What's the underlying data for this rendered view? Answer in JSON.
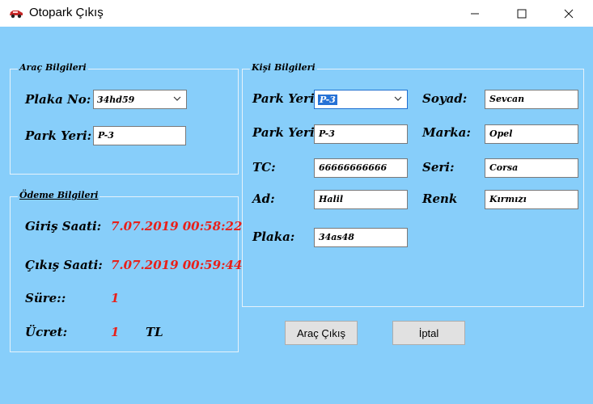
{
  "window": {
    "title": "Otopark Çıkış",
    "minimize_glyph": "—",
    "maximize_glyph": "☐",
    "close_glyph": "✕"
  },
  "arac_group": {
    "title": "Araç Bilgileri",
    "plaka_label": "Plaka No:",
    "plaka_value": "34hd59",
    "park_label": "Park Yeri:",
    "park_value": "P-3"
  },
  "odeme_group": {
    "title": "Ödeme Bilgileri",
    "giris_label": "Giriş Saati:",
    "giris_value": "7.07.2019 00:58:22",
    "cikis_label": "Çıkış Saati:",
    "cikis_value": "7.07.2019 00:59:44",
    "sure_label": "Süre::",
    "sure_value": "1",
    "ucret_label": "Ücret:",
    "ucret_value": "1",
    "ucret_unit": "TL"
  },
  "kisi_group": {
    "title": "Kişi Bilgileri",
    "park_combo_label": "Park Yeri",
    "park_combo_value": "P-3",
    "park_text_label": "Park Yeri",
    "park_text_value": "P-3",
    "tc_label": "TC:",
    "tc_value": "66666666666",
    "ad_label": "Ad:",
    "ad_value": "Halil",
    "plaka_label": "Plaka:",
    "plaka_value": "34as48",
    "soyad_label": "Soyad:",
    "soyad_value": "Sevcan",
    "marka_label": "Marka:",
    "marka_value": "Opel",
    "seri_label": "Seri:",
    "seri_value": "Corsa",
    "renk_label": "Renk",
    "renk_value": "Kırmızı"
  },
  "buttons": {
    "arac_cikis": "Araç Çıkış",
    "iptal": "İptal"
  },
  "colors": {
    "background": "#87cefa",
    "accent_red": "#e8201a",
    "selection_blue": "#2672d6"
  }
}
